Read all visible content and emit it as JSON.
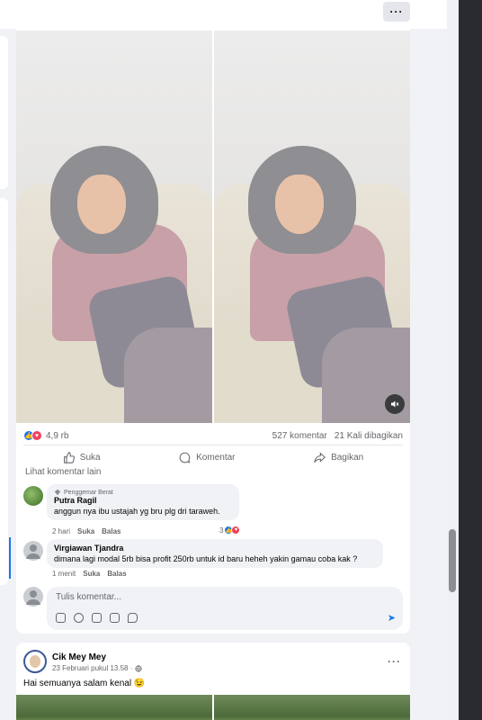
{
  "topbar": {
    "more_icon": "more-horizontal-icon",
    "more_label": "···"
  },
  "post": {
    "reactions": {
      "types": [
        "like",
        "love"
      ],
      "count": "4,9 rb"
    },
    "comments_count": "527 komentar",
    "shares_count": "21 Kali dibagikan",
    "actions": {
      "like": "Suka",
      "comment": "Komentar",
      "share": "Bagikan"
    },
    "more_comments": "Lihat komentar lain",
    "mute_icon": "speaker-mute-icon"
  },
  "comments": [
    {
      "badge": "Penggemar Berat",
      "name": "Putra Ragil",
      "text": "anggun nya ibu ustajah yg bru plg dri taraweh.",
      "time": "2 hari",
      "like": "Suka",
      "reply": "Balas",
      "reaction_count": "3"
    },
    {
      "name": "Virgiawan Tjandra",
      "text": "dimana lagi modal 5rb bisa profit 250rb untuk id baru heheh yakin gamau coba kak ?",
      "time": "1 menit",
      "like": "Suka",
      "reply": "Balas"
    }
  ],
  "composer": {
    "placeholder": "Tulis komentar...",
    "tools": [
      "gif-icon",
      "emoji-icon",
      "camera-icon",
      "gif-sticker-icon",
      "sticker-icon"
    ],
    "send_icon": "send-icon",
    "send_glyph": "➤"
  },
  "next_post": {
    "author": "Cik Mey Mey",
    "date": "23 Februari pukul 13.58 ·",
    "privacy_icon": "globe-icon",
    "text": "Hai semuanya salam kenal 😉",
    "more_label": "···"
  },
  "colors": {
    "accent": "#1877f2",
    "love": "#f33e58",
    "muted_text": "#65676b",
    "bg": "#f0f2f5"
  }
}
